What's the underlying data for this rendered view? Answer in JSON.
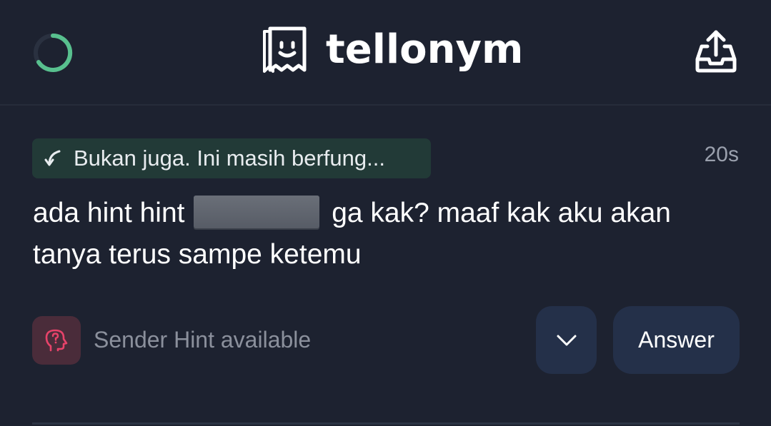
{
  "header": {
    "brand_name": "tellonym",
    "icons": {
      "spinner": "loading-spinner-icon",
      "logo": "tellonym-logo-icon",
      "share": "share-inbox-icon"
    }
  },
  "message": {
    "reply_to_preview": "Bukan juga. Ini masih berfung...",
    "timestamp": "20s",
    "text_before": "ada hint hint",
    "text_after": "ga kak? maaf kak aku akan tanya terus sampe ketemu"
  },
  "footer": {
    "sender_hint_label": "Sender Hint available",
    "answer_label": "Answer"
  },
  "colors": {
    "background": "#1d2230",
    "reply_chip": "#223a37",
    "button": "#243049",
    "hint_icon_bg": "#4a2c3a",
    "hint_icon": "#e8436a",
    "spinner": "#58c08e"
  }
}
